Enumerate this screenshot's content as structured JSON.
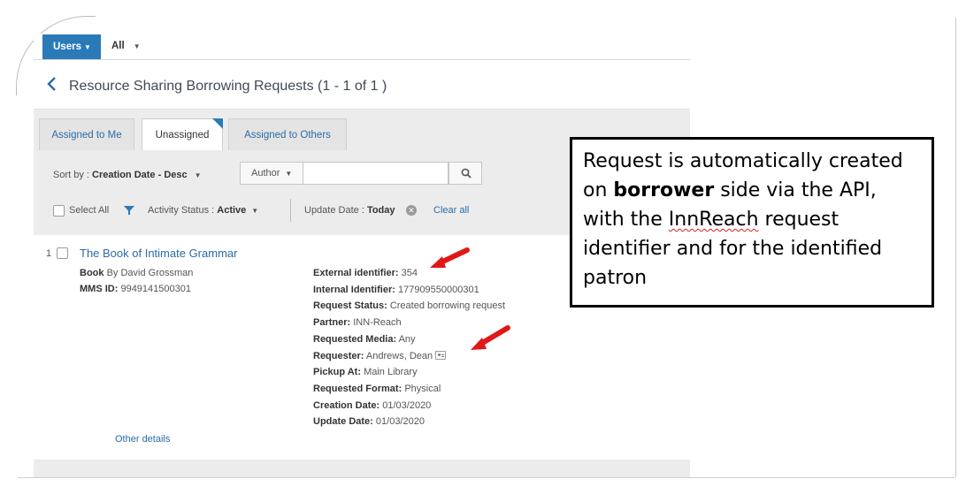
{
  "topbar": {
    "users_label": "Users",
    "scope_label": "All"
  },
  "page": {
    "title": "Resource Sharing Borrowing Requests (1 - 1 of 1 )"
  },
  "tabs": [
    {
      "label": "Assigned to Me",
      "active": false
    },
    {
      "label": "Unassigned",
      "active": true
    },
    {
      "label": "Assigned to Others",
      "active": false
    }
  ],
  "filters": {
    "sort_prefix": "Sort by :",
    "sort_value": "Creation Date - Desc",
    "search_field": "Author",
    "search_value": "",
    "select_all": "Select All",
    "activity_prefix": "Activity Status :",
    "activity_value": "Active",
    "update_prefix": "Update Date :",
    "update_value": "Today",
    "clear_all": "Clear all"
  },
  "record": {
    "index": "1",
    "title": "The Book of Intimate Grammar",
    "type_label": "Book",
    "author_text": "By David Grossman",
    "mms_label": "MMS ID:",
    "mms_value": "9949141500301",
    "fields": [
      {
        "label": "External identifier:",
        "value": "354"
      },
      {
        "label": "Internal Identifier:",
        "value": "177909550000301"
      },
      {
        "label": "Request Status:",
        "value": "Created borrowing request"
      },
      {
        "label": "Partner:",
        "value": "INN-Reach"
      },
      {
        "label": "Requested Media:",
        "value": "Any"
      },
      {
        "label": "Requester:",
        "value": "Andrews, Dean"
      },
      {
        "label": "Pickup At:",
        "value": "Main Library"
      },
      {
        "label": "Requested Format:",
        "value": "Physical"
      },
      {
        "label": "Creation Date:",
        "value": "01/03/2020"
      },
      {
        "label": "Update Date:",
        "value": "01/03/2020"
      }
    ],
    "other_details": "Other details"
  },
  "callout": {
    "line1": "Request is automatically created",
    "line2_pre": "on",
    "line2_bold": "borrower",
    "line2_post": "side via the API,",
    "line3_pre": "with the",
    "line3_squiggle": "InnReach",
    "line3_post": "request",
    "line4": "identifier and for the identified",
    "line5": "patron"
  },
  "colors": {
    "accent": "#2a7ab8",
    "link": "#2a6ca8",
    "arrow": "#e01818"
  }
}
